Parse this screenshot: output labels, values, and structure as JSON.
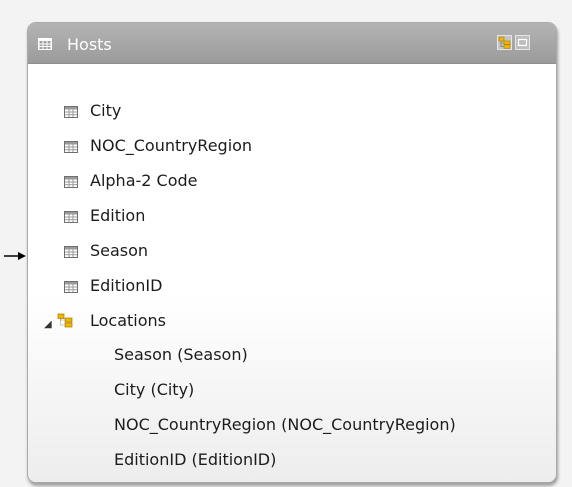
{
  "table": {
    "title": "Hosts",
    "header_buttons": [
      "hierarchy-toggle",
      "minimize"
    ],
    "columns": [
      {
        "label": "City",
        "icon": "column-icon"
      },
      {
        "label": "NOC_CountryRegion",
        "icon": "column-icon"
      },
      {
        "label": "Alpha-2 Code",
        "icon": "column-icon"
      },
      {
        "label": "Edition",
        "icon": "column-icon"
      },
      {
        "label": "Season",
        "icon": "column-icon"
      },
      {
        "label": "EditionID",
        "icon": "column-icon"
      }
    ],
    "hierarchy": {
      "label": "Locations",
      "icon": "hierarchy-icon",
      "expanded": true,
      "levels": [
        "Season (Season)",
        "City (City)",
        "NOC_CountryRegion (NOC_CountryRegion)",
        "EditionID (EditionID)"
      ]
    }
  },
  "colors": {
    "header_top": "#b4b4b4",
    "header_bottom": "#9b9b9b",
    "border": "#a9a9a9",
    "text": "#1c1c1c",
    "hierarchy_icon": "#f2b600"
  }
}
